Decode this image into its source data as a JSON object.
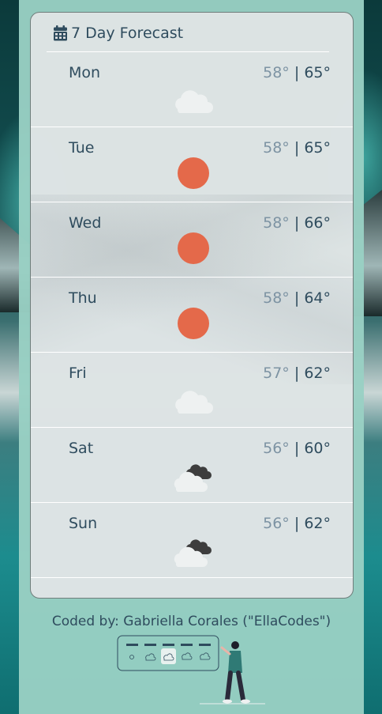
{
  "forecast": {
    "title": "7 Day Forecast",
    "title_icon": "calendar-icon",
    "separator": "|",
    "days": [
      {
        "day": "Mon",
        "low": "58°",
        "high": "65°",
        "icon": "cloud-light"
      },
      {
        "day": "Tue",
        "low": "58°",
        "high": "65°",
        "icon": "sun"
      },
      {
        "day": "Wed",
        "low": "58°",
        "high": "66°",
        "icon": "sun"
      },
      {
        "day": "Thu",
        "low": "58°",
        "high": "64°",
        "icon": "sun"
      },
      {
        "day": "Fri",
        "low": "57°",
        "high": "62°",
        "icon": "cloud-light"
      },
      {
        "day": "Sat",
        "low": "56°",
        "high": "60°",
        "icon": "cloud-dark"
      },
      {
        "day": "Sun",
        "low": "56°",
        "high": "62°",
        "icon": "cloud-dark"
      }
    ]
  },
  "footer": {
    "credit": "Coded by: Gabriella Corales (\"EllaCodes\")"
  },
  "colors": {
    "text": "#2f4c5e",
    "low_temp": "#7d93a3",
    "sun": "#e4694a",
    "cloud_light": "#eef1f1",
    "cloud_dark": "#3d3d3d"
  }
}
